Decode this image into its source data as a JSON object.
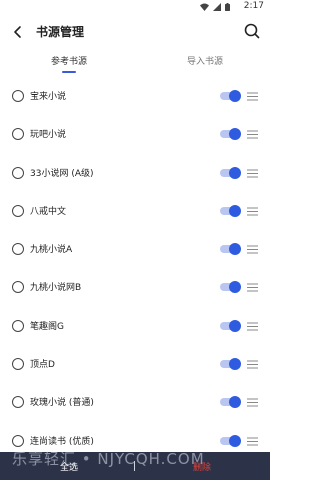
{
  "status_bar": {
    "time": "2:17"
  },
  "app_bar": {
    "title": "书源管理"
  },
  "tabs": [
    {
      "label": "参考书源",
      "active": true
    },
    {
      "label": "导入书源",
      "active": false
    }
  ],
  "sources": [
    {
      "name": "宝来小说",
      "enabled": true,
      "checked": false
    },
    {
      "name": "玩吧小说",
      "enabled": true,
      "checked": false
    },
    {
      "name": "33小说网 (A级)",
      "enabled": true,
      "checked": false
    },
    {
      "name": "八戒中文",
      "enabled": true,
      "checked": false
    },
    {
      "name": "九桃小说A",
      "enabled": true,
      "checked": false
    },
    {
      "name": "九桃小说网B",
      "enabled": true,
      "checked": false
    },
    {
      "name": "笔趣阁G",
      "enabled": true,
      "checked": false
    },
    {
      "name": "顶点D",
      "enabled": true,
      "checked": false
    },
    {
      "name": "玫瑰小说 (普通)",
      "enabled": true,
      "checked": false
    },
    {
      "name": "连尚读书 (优质)",
      "enabled": true,
      "checked": false
    }
  ],
  "bottom_bar": {
    "select_all": "全选",
    "delete": "删除"
  },
  "watermark": "乐享轻汇 • NJYCQH.COM",
  "colors": {
    "accent": "#2f5be0",
    "bottom_bar": "#2c3247",
    "delete": "#e0413b"
  }
}
